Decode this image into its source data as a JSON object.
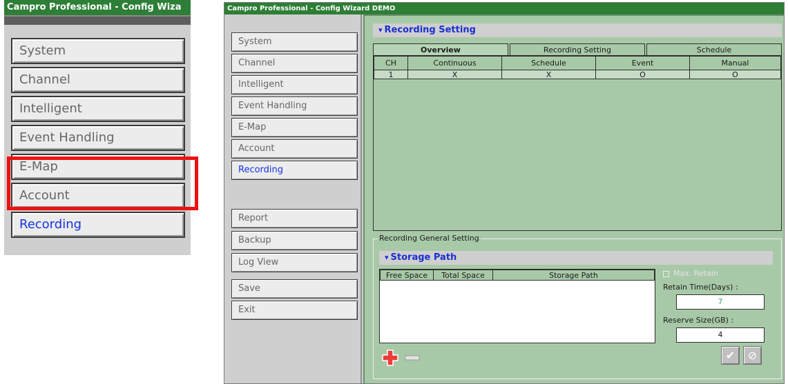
{
  "zoom": {
    "title": "Campro Professional - Config Wiza",
    "menu": [
      "System",
      "Channel",
      "Intelligent",
      "Event Handling",
      "E-Map",
      "Account",
      "Recording"
    ],
    "active_index": 6,
    "highlight_color": "#ee1111"
  },
  "app": {
    "title": "Campro Professional - Config Wizard DEMO",
    "sidebar": {
      "top_items": [
        "System",
        "Channel",
        "Intelligent",
        "Event Handling",
        "E-Map",
        "Account",
        "Recording"
      ],
      "mid_items": [
        "Report",
        "Backup",
        "Log View"
      ],
      "bottom_items": [
        "Save",
        "Exit"
      ],
      "active": "Recording"
    },
    "recording_setting": {
      "header": "Recording Setting",
      "tabs": [
        "Overview",
        "Recording Setting",
        "Schedule"
      ],
      "active_tab": "Overview",
      "overview_columns": [
        "CH",
        "Continuous",
        "Schedule",
        "Event",
        "Manual"
      ],
      "overview_rows": [
        [
          "1",
          "X",
          "X",
          "O",
          "O"
        ]
      ]
    },
    "general": {
      "legend": "Recording General Setting",
      "storage_header": "Storage Path",
      "storage_columns": [
        "Free Space",
        "Total Space",
        "Storage Path"
      ],
      "max_retain_label": "Max. Retain",
      "retain_time_label": "Retain Time(Days) :",
      "retain_time_value": "7",
      "reserve_size_label": "Reserve Size(GB) :",
      "reserve_size_value": "4"
    },
    "colors": {
      "title_bar": "#2d7e36",
      "content_bg": "#a8c9a8",
      "accent_text": "#1a2fd0",
      "add_icon": "#ee3b3b"
    },
    "icons": [
      "section-collapse-icon",
      "add-icon",
      "remove-icon",
      "apply-check-icon",
      "cancel-icon"
    ]
  }
}
